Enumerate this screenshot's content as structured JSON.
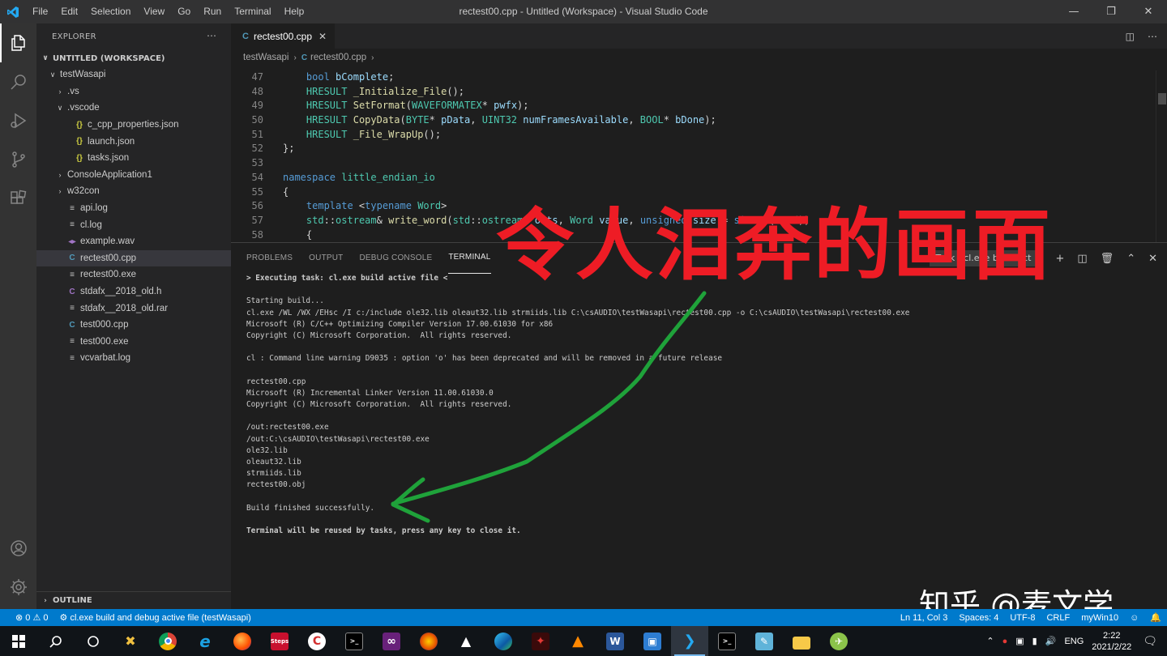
{
  "window": {
    "title": "rectest00.cpp - Untitled (Workspace) - Visual Studio Code",
    "menu": [
      "File",
      "Edit",
      "Selection",
      "View",
      "Go",
      "Run",
      "Terminal",
      "Help"
    ]
  },
  "sidebar": {
    "header": "EXPLORER",
    "workspace": "UNTITLED (WORKSPACE)",
    "tree": [
      {
        "label": "testWasapi",
        "indent": 1,
        "twisty": "open",
        "icon": ""
      },
      {
        "label": ".vs",
        "indent": 2,
        "twisty": "closed",
        "icon": ""
      },
      {
        "label": ".vscode",
        "indent": 2,
        "twisty": "open",
        "icon": ""
      },
      {
        "label": "c_cpp_properties.json",
        "indent": 3,
        "twisty": "",
        "icon": "json"
      },
      {
        "label": "launch.json",
        "indent": 3,
        "twisty": "",
        "icon": "json"
      },
      {
        "label": "tasks.json",
        "indent": 3,
        "twisty": "",
        "icon": "json"
      },
      {
        "label": "ConsoleApplication1",
        "indent": 2,
        "twisty": "closed",
        "icon": ""
      },
      {
        "label": "w32con",
        "indent": 2,
        "twisty": "closed",
        "icon": ""
      },
      {
        "label": "api.log",
        "indent": 2,
        "twisty": "",
        "icon": "lines"
      },
      {
        "label": "cl.log",
        "indent": 2,
        "twisty": "",
        "icon": "lines"
      },
      {
        "label": "example.wav",
        "indent": 2,
        "twisty": "",
        "icon": "audio"
      },
      {
        "label": "rectest00.cpp",
        "indent": 2,
        "twisty": "",
        "icon": "cpp",
        "selected": true
      },
      {
        "label": "rectest00.exe",
        "indent": 2,
        "twisty": "",
        "icon": "lines"
      },
      {
        "label": "stdafx__2018_old.h",
        "indent": 2,
        "twisty": "",
        "icon": "h"
      },
      {
        "label": "stdafx__2018_old.rar",
        "indent": 2,
        "twisty": "",
        "icon": "lines"
      },
      {
        "label": "test000.cpp",
        "indent": 2,
        "twisty": "",
        "icon": "cpp"
      },
      {
        "label": "test000.exe",
        "indent": 2,
        "twisty": "",
        "icon": "lines"
      },
      {
        "label": "vcvarbat.log",
        "indent": 2,
        "twisty": "",
        "icon": "lines"
      }
    ],
    "outline": "OUTLINE"
  },
  "editor": {
    "tab_label": "rectest00.cpp",
    "breadcrumb": [
      "testWasapi",
      "rectest00.cpp"
    ],
    "lines": [
      {
        "n": "47",
        "t": "    <span class=\"kw\">bool</span> <span class=\"pm\">bComplete</span>;"
      },
      {
        "n": "48",
        "t": "    <span class=\"ty\">HRESULT</span> <span class=\"fn\">_Initialize_File</span>();"
      },
      {
        "n": "49",
        "t": "    <span class=\"ty\">HRESULT</span> <span class=\"fn\">SetFormat</span>(<span class=\"ty\">WAVEFORMATEX</span>* <span class=\"pm\">pwfx</span>);"
      },
      {
        "n": "50",
        "t": "    <span class=\"ty\">HRESULT</span> <span class=\"fn\">CopyData</span>(<span class=\"ty\">BYTE</span>* <span class=\"pm\">pData</span>, <span class=\"ty\">UINT32</span> <span class=\"pm\">numFramesAvailable</span>, <span class=\"ty\">BOOL</span>* <span class=\"pm\">bDone</span>);"
      },
      {
        "n": "51",
        "t": "    <span class=\"ty\">HRESULT</span> <span class=\"fn\">_File_WrapUp</span>();"
      },
      {
        "n": "52",
        "t": "};"
      },
      {
        "n": "53",
        "t": ""
      },
      {
        "n": "54",
        "t": "<span class=\"kw\">namespace</span> <span class=\"ty\">little_endian_io</span>"
      },
      {
        "n": "55",
        "t": "{"
      },
      {
        "n": "56",
        "t": "    <span class=\"kw\">template</span> &lt;<span class=\"kw\">typename</span> <span class=\"ty\">Word</span>&gt;"
      },
      {
        "n": "57",
        "t": "    <span class=\"ty\">std</span>::<span class=\"ty\">ostream</span>&amp; <span class=\"fn\">write_word</span>(<span class=\"ty\">std</span>::<span class=\"ty\">ostream</span>&amp; <span class=\"pm\">outs</span>, <span class=\"ty\">Word</span> <span class=\"pm\">value</span>, <span class=\"kw\">unsigned</span> <span class=\"pm\">size</span> = <span class=\"kw\">sizeof</span>(<span class=\"ty\">Word</span>))"
      },
      {
        "n": "58",
        "t": "    {"
      }
    ]
  },
  "panel": {
    "tabs": [
      "PROBLEMS",
      "OUTPUT",
      "DEBUG CONSOLE",
      "TERMINAL"
    ],
    "active_tab": "TERMINAL",
    "task_select": "Task - cl.exe build act",
    "terminal_lines": [
      {
        "t": "> Executing task: cl.exe build active file <",
        "b": true
      },
      {
        "t": "",
        "b": false
      },
      {
        "t": "Starting build...",
        "b": false
      },
      {
        "t": "cl.exe /WL /WX /EHsc /I c:/include ole32.lib oleaut32.lib strmiids.lib C:\\csAUDIO\\testWasapi\\rectest00.cpp -o C:\\csAUDIO\\testWasapi\\rectest00.exe",
        "b": false
      },
      {
        "t": "Microsoft (R) C/C++ Optimizing Compiler Version 17.00.61030 for x86",
        "b": false
      },
      {
        "t": "Copyright (C) Microsoft Corporation.  All rights reserved.",
        "b": false
      },
      {
        "t": "",
        "b": false
      },
      {
        "t": "cl : Command line warning D9035 : option 'o' has been deprecated and will be removed in a future release",
        "b": false
      },
      {
        "t": "",
        "b": false
      },
      {
        "t": "rectest00.cpp",
        "b": false
      },
      {
        "t": "Microsoft (R) Incremental Linker Version 11.00.61030.0",
        "b": false
      },
      {
        "t": "Copyright (C) Microsoft Corporation.  All rights reserved.",
        "b": false
      },
      {
        "t": "",
        "b": false
      },
      {
        "t": "/out:rectest00.exe",
        "b": false
      },
      {
        "t": "/out:C:\\csAUDIO\\testWasapi\\rectest00.exe",
        "b": false
      },
      {
        "t": "ole32.lib",
        "b": false
      },
      {
        "t": "oleaut32.lib",
        "b": false
      },
      {
        "t": "strmiids.lib",
        "b": false
      },
      {
        "t": "rectest00.obj",
        "b": false
      },
      {
        "t": "",
        "b": false
      },
      {
        "t": "Build finished successfully.",
        "b": false
      },
      {
        "t": "",
        "b": false
      },
      {
        "t": "Terminal will be reused by tasks, press any key to close it.",
        "b": true
      }
    ]
  },
  "overlay": {
    "caption": "令人泪奔的画面",
    "caption_color": "#ee1c25",
    "arrow_color": "#1fa23a",
    "watermark": "知乎 @麦文学"
  },
  "status": {
    "errors": "0",
    "warnings": "0",
    "task": "cl.exe build and debug active file (testWasapi)",
    "position": "Ln 11, Col 3",
    "spaces": "Spaces: 4",
    "encoding": "UTF-8",
    "eol": "CRLF",
    "platform": "myWin10"
  },
  "taskbar": {
    "language": "ENG",
    "time": "2:22",
    "date": "2021/2/22"
  },
  "colors": {
    "accent": "#007acc",
    "titlebar": "#323233",
    "activitybar": "#333333",
    "sidebar": "#252526",
    "editor": "#1e1e1e"
  }
}
